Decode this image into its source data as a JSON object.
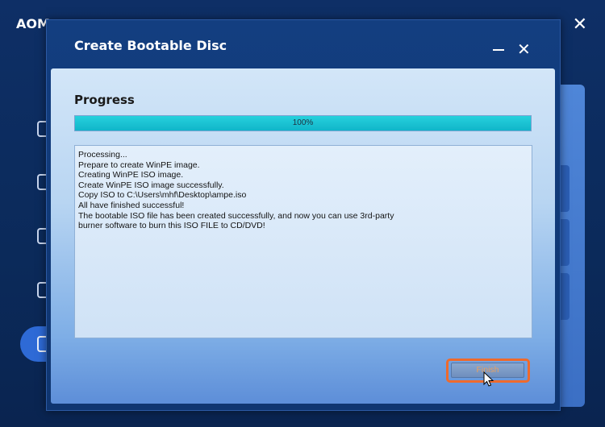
{
  "app": {
    "title": "AOM",
    "close_symbol": "✕",
    "sidebar_icons": [
      "disc-icon",
      "disc-icon",
      "disc-icon",
      "disc-icon",
      "disc-icon"
    ]
  },
  "dialog": {
    "title": "Create Bootable Disc",
    "close_symbol": "✕",
    "progress": {
      "heading": "Progress",
      "percent_label": "100%",
      "fraction": 1.0,
      "fill_color": "#10b5c9"
    },
    "log_lines": [
      "Processing...",
      "Prepare to create WinPE image.",
      "Creating WinPE ISO image.",
      "Create WinPE ISO image successfully.",
      "Copy ISO to C:\\Users\\mhf\\Desktop\\ampe.iso",
      "All have finished successful!",
      "The bootable ISO file has been created successfully, and now you can use 3rd-party",
      "burner software to burn this ISO FILE to CD/DVD!"
    ],
    "finish_label": "Finish",
    "highlight_color": "#ef6a2c"
  }
}
